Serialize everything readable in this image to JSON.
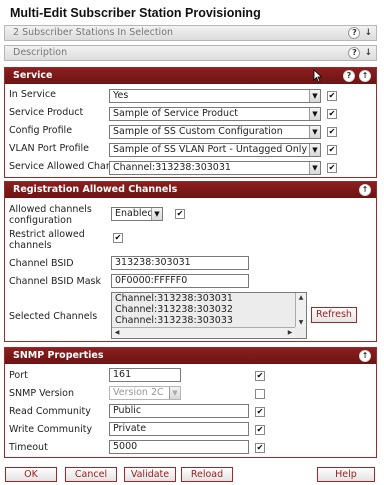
{
  "title": "Multi-Edit Subscriber Station Provisioning",
  "selection_bar": {
    "label": "2 Subscriber Stations In Selection"
  },
  "description_bar": {
    "label": "Description"
  },
  "service": {
    "header": "Service",
    "rows": [
      {
        "label": "In Service",
        "value": "Yes"
      },
      {
        "label": "Service Product",
        "value": "Sample of Service Product"
      },
      {
        "label": "Config Profile",
        "value": "Sample of SS Custom Configuration"
      },
      {
        "label": "VLAN Port Profile",
        "value": "Sample of SS VLAN Port - Untagged Only"
      },
      {
        "label": "Service Allowed Channel",
        "value": "Channel:313238:303031"
      }
    ]
  },
  "registration": {
    "header": "Registration Allowed Channels",
    "allowed_label": "Allowed channels configuration",
    "allowed_value": "Enabled",
    "restrict_label": "Restrict allowed channels",
    "bsid_label": "Channel BSID",
    "bsid_value": "313238:303031",
    "mask_label": "Channel BSID Mask",
    "mask_value": "0F0000:FFFFF0",
    "selected_label": "Selected Channels",
    "selected_items": [
      "Channel:313238:303031",
      "Channel:313238:303032",
      "Channel:313238:303033"
    ],
    "refresh_label": "Refresh"
  },
  "snmp": {
    "header": "SNMP Properties",
    "port_label": "Port",
    "port_value": "161",
    "version_label": "SNMP Version",
    "version_value": "Version 2C",
    "read_label": "Read Community",
    "read_value": "Public",
    "write_label": "Write Community",
    "write_value": "Private",
    "timeout_label": "Timeout",
    "timeout_value": "5000"
  },
  "footer": {
    "ok": "OK",
    "cancel": "Cancel",
    "validate": "Validate",
    "reload": "Reload",
    "help": "Help"
  },
  "icons": {
    "help": "?",
    "collapse": "»"
  },
  "colors": {
    "accent": "#8c1f1f",
    "button_text": "#9b1b1b"
  }
}
